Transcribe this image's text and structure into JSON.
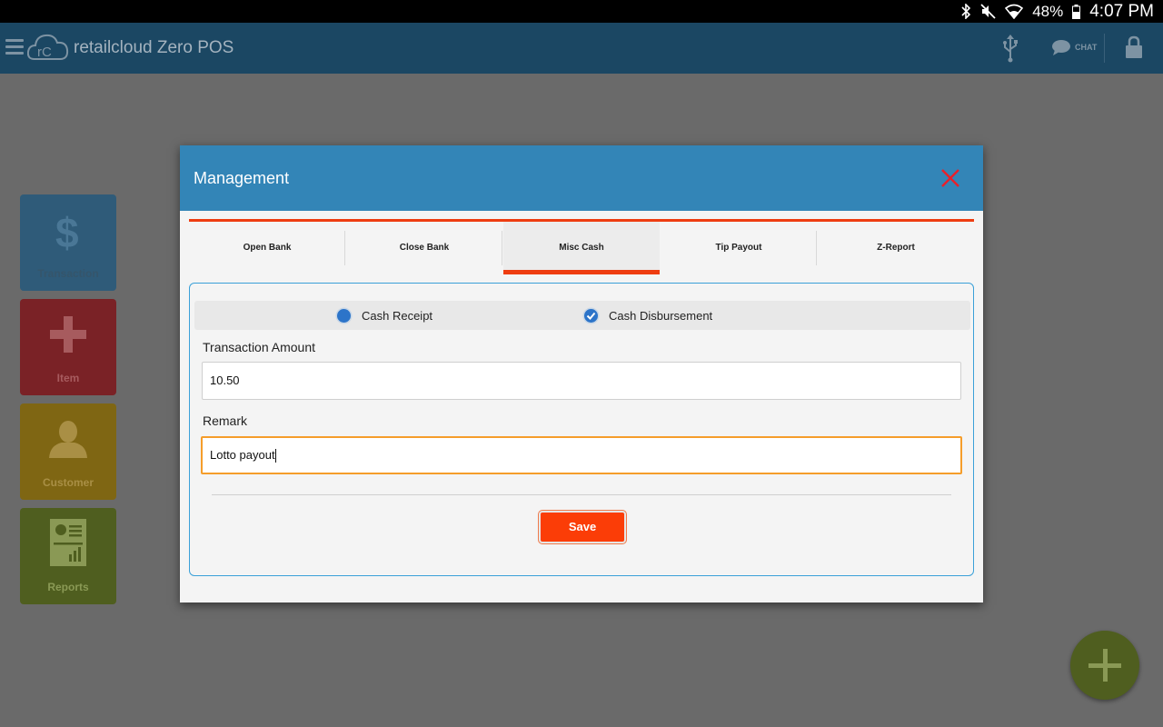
{
  "status_bar": {
    "battery": "48%",
    "time": "4:07 PM"
  },
  "app_bar": {
    "logo_text": "rC",
    "title": "retailcloud Zero POS",
    "chat_label": "CHAT"
  },
  "sidebar": {
    "tiles": [
      {
        "label": "Transaction",
        "icon": "dollar-icon"
      },
      {
        "label": "Item",
        "icon": "plus-icon"
      },
      {
        "label": "Customer",
        "icon": "person-icon"
      },
      {
        "label": "Reports",
        "icon": "report-icon"
      }
    ]
  },
  "dialog": {
    "title": "Management",
    "tabs": [
      {
        "label": "Open Bank"
      },
      {
        "label": "Close Bank"
      },
      {
        "label": "Misc Cash"
      },
      {
        "label": "Tip Payout"
      },
      {
        "label": "Z-Report"
      }
    ],
    "active_tab": "Misc Cash",
    "radio_options": [
      {
        "label": "Cash Receipt",
        "selected": false
      },
      {
        "label": "Cash Disbursement",
        "selected": true
      }
    ],
    "transaction_amount": {
      "label": "Transaction Amount",
      "value": "10.50"
    },
    "remark": {
      "label": "Remark",
      "value": "Lotto payout"
    },
    "save_label": "Save"
  },
  "colors": {
    "header_blue": "#3385b7",
    "accent_orange": "#ee3d11",
    "save_button": "#fb3d07",
    "focus_orange": "#f59d2a"
  }
}
